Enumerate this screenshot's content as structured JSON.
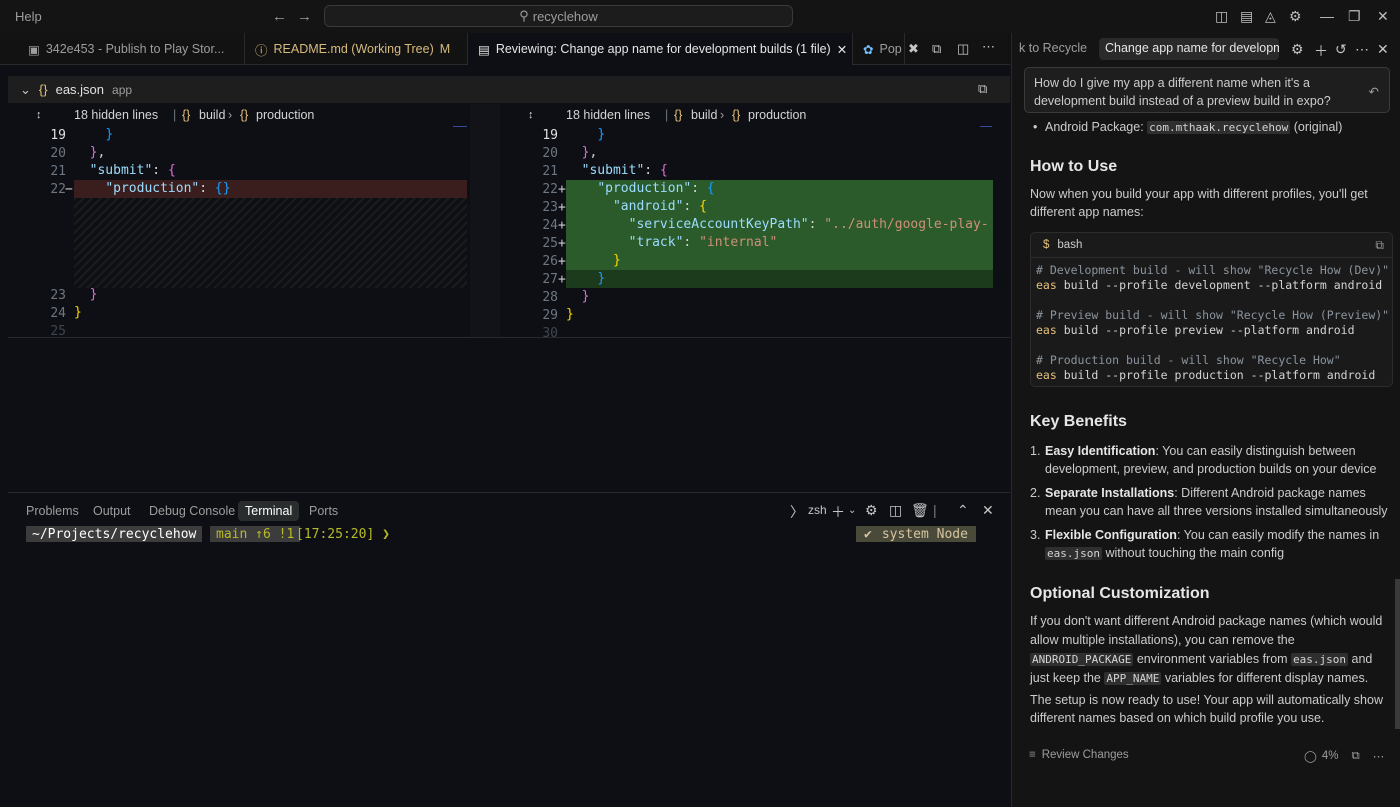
{
  "titlebar": {
    "menu_help": "Help",
    "search_text": "recyclehow"
  },
  "editor_tabs": [
    {
      "label": "342e453 - Publish to Play Stor...",
      "active": false
    },
    {
      "label": "README.md (Working Tree)",
      "badge": "M",
      "active": false
    },
    {
      "label": "Reviewing: Change app name for development builds (1 file)",
      "active": true
    },
    {
      "label": "Pop",
      "active": false
    }
  ],
  "file": {
    "name": "eas.json",
    "desc": "app"
  },
  "diff": {
    "hidden_label": "18 hidden lines",
    "crumb_1": "build",
    "crumb_2": "production",
    "left_lines": [
      "19",
      "20",
      "21",
      "22",
      "23",
      "24",
      "25"
    ],
    "left_del_marker": "−",
    "right_lines": [
      "19",
      "20",
      "21",
      "22",
      "23",
      "24",
      "25",
      "26",
      "27",
      "28",
      "29",
      "30"
    ],
    "right_add_marker": "+",
    "k_submit": "\"submit\"",
    "k_production": "\"production\"",
    "k_android": "\"android\"",
    "k_service": "\"serviceAccountKeyPath\"",
    "v_service": "\"../auth/google-play-",
    "k_track": "\"track\"",
    "v_track": "\"internal\""
  },
  "panel": {
    "tabs": [
      "Problems",
      "Output",
      "Debug Console",
      "Terminal",
      "Ports"
    ],
    "active_tab": "Terminal",
    "shell": "zsh",
    "prompt_path": "~/Projects/recyclehow",
    "prompt_git": "main ↑6 !1",
    "prompt_time": "[17:25:20] ❯",
    "prompt_check": "✔",
    "prompt_node": "system Node"
  },
  "chat": {
    "tab_prev": "k to Recycle",
    "tab_active": "Change app name for developmen",
    "question": "How do I give my app a different name when it's a development build instead of a preview build in expo?",
    "android_package_label": "Android Package:",
    "android_package_value": "com.mthaak.recyclehow",
    "android_package_suffix": "(original)",
    "how_to_use_heading": "How to Use",
    "how_to_use_text": "Now when you build your app with different profiles, you'll get different app names:",
    "code_lang": "bash",
    "code_lines": [
      {
        "comment": "# Development build - will show \"Recycle How (Dev)\""
      },
      {
        "cmd": "eas",
        "rest": " build --profile development --platform android"
      },
      {
        "comment": "# Preview build - will show \"Recycle How (Preview)\""
      },
      {
        "cmd": "eas",
        "rest": " build --profile preview --platform android"
      },
      {
        "comment": "# Production build - will show \"Recycle How\""
      },
      {
        "cmd": "eas",
        "rest": " build --profile production --platform android"
      }
    ],
    "key_benefits_heading": "Key Benefits",
    "benefits": [
      {
        "num": "1.",
        "title": "Easy Identification",
        "text": ": You can easily distinguish between development, preview, and production builds on your device"
      },
      {
        "num": "2.",
        "title": "Separate Installations",
        "text": ": Different Android package names mean you can have all three versions installed simultaneously"
      },
      {
        "num": "3.",
        "title": "Flexible Configuration",
        "text": ": You can easily modify the names in ",
        "code": "eas.json",
        "text2": " without touching the main config"
      }
    ],
    "optional_heading": "Optional Customization",
    "optional_p1_a": "If you don't want different Android package names (which would allow multiple installations), you can remove the ",
    "optional_p1_code1": "ANDROID_PACKAGE",
    "optional_p1_b": " environment variables from ",
    "optional_p1_code2": "eas.json",
    "optional_p1_c": " and just keep the ",
    "optional_p1_code3": "APP_NAME",
    "optional_p1_d": " variables for different display names.",
    "optional_p2": "The setup is now ready to use! Your app will automatically show different names based on which build profile you use.",
    "footer_review": "Review Changes",
    "footer_progress": "4%"
  }
}
